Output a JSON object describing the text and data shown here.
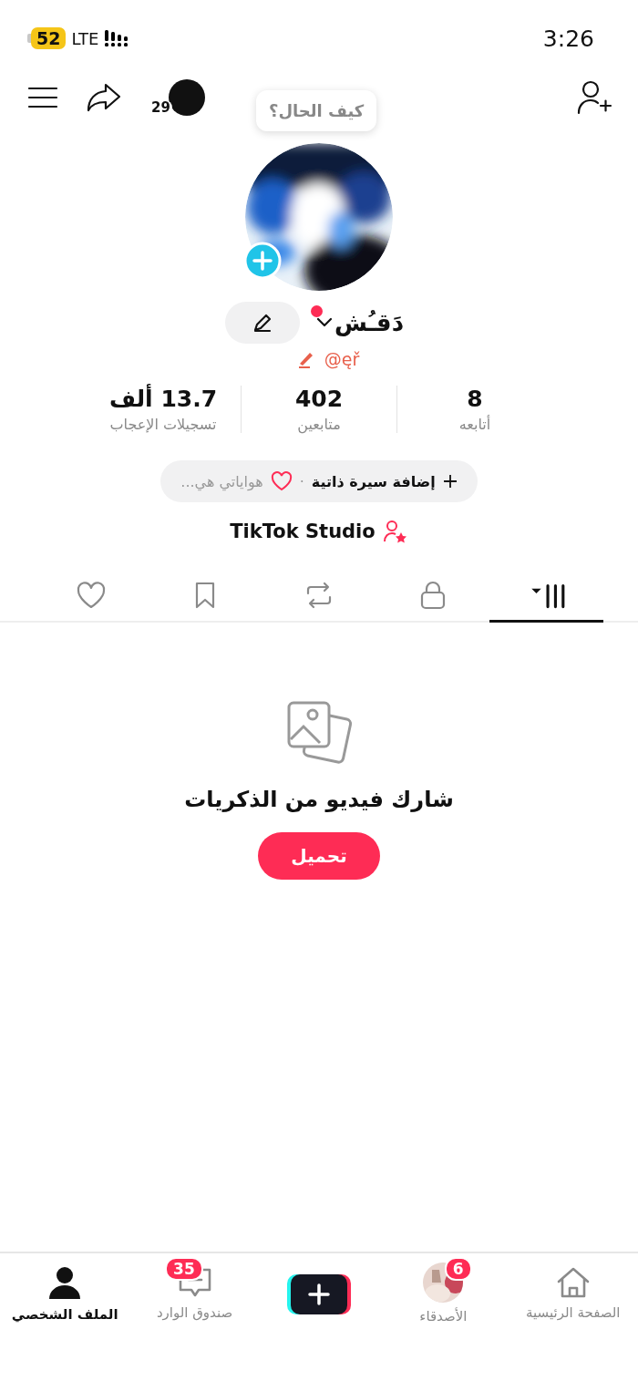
{
  "status_bar": {
    "battery": "52",
    "network": "LTE",
    "time": "3:26"
  },
  "top_bar": {
    "notification_count": "29"
  },
  "profile": {
    "tooltip": "كيف الحال؟",
    "name": "دَقـُش",
    "handle": "@ęř",
    "has_new_dot": true
  },
  "stats": [
    {
      "value": "8",
      "label": "أتابعه"
    },
    {
      "value": "402",
      "label": "متابعين"
    },
    {
      "value": "13.7 ألف",
      "label": "تسجيلات الإعجاب"
    }
  ],
  "bio": {
    "action": "إضافة سيرة ذاتية",
    "separator": "·",
    "hint": "هواياتي هي..."
  },
  "studio": {
    "label": "TikTok Studio"
  },
  "tabs": [
    {
      "kind": "grid",
      "selected": true
    },
    {
      "kind": "lock",
      "selected": false
    },
    {
      "kind": "repost",
      "selected": false
    },
    {
      "kind": "bookmark",
      "selected": false
    },
    {
      "kind": "heart",
      "selected": false
    }
  ],
  "empty_state": {
    "title": "شارك فيديو من الذكريات",
    "button": "تحميل"
  },
  "nav": [
    {
      "kind": "home",
      "label": "الصفحة الرئيسية",
      "selected": false
    },
    {
      "kind": "friends",
      "label": "الأصدقاء",
      "badge": "6",
      "selected": false
    },
    {
      "kind": "create"
    },
    {
      "kind": "inbox",
      "label": "صندوق الوارد",
      "badge": "35",
      "selected": false
    },
    {
      "kind": "profile",
      "label": "الملف الشخصي",
      "selected": true
    }
  ]
}
